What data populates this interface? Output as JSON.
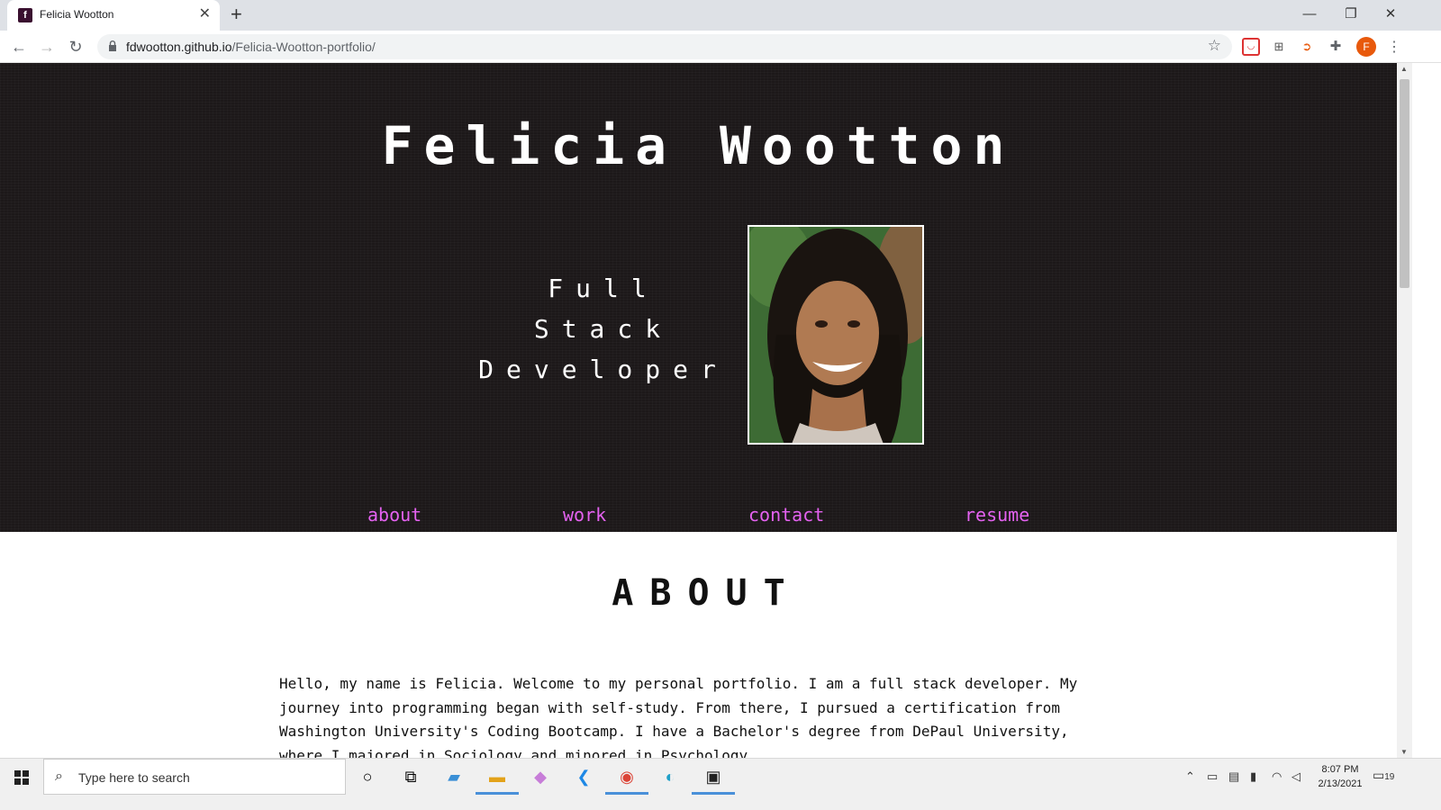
{
  "browser": {
    "tab_title": "Felicia Wootton",
    "favicon_letter": "f",
    "url_host": "fdwootton.github.io",
    "url_path": "/Felicia-Wootton-portfolio/",
    "profile_initial": "F"
  },
  "hero": {
    "name": "Felicia Wootton",
    "tagline": [
      "Full",
      "Stack",
      "Developer"
    ],
    "nav": [
      "about",
      "work",
      "contact",
      "resume"
    ]
  },
  "about": {
    "title": "ABOUT",
    "lines": [
      "Hello, my name is Felicia. Welcome to my personal portfolio. I am a full stack developer. My",
      "journey into programming began with self-study. From there, I pursued a certification from",
      "Washington University's Coding Bootcamp. I have a Bachelor's degree from DePaul University,",
      "where I majored in Sociology and minored in Psychology."
    ]
  },
  "taskbar": {
    "search_placeholder": "Type here to search",
    "time": "8:07 PM",
    "date": "2/13/2021",
    "notification_count": "19"
  },
  "colors": {
    "hero_bg": "#1c1819",
    "nav_link": "#e462f0"
  }
}
